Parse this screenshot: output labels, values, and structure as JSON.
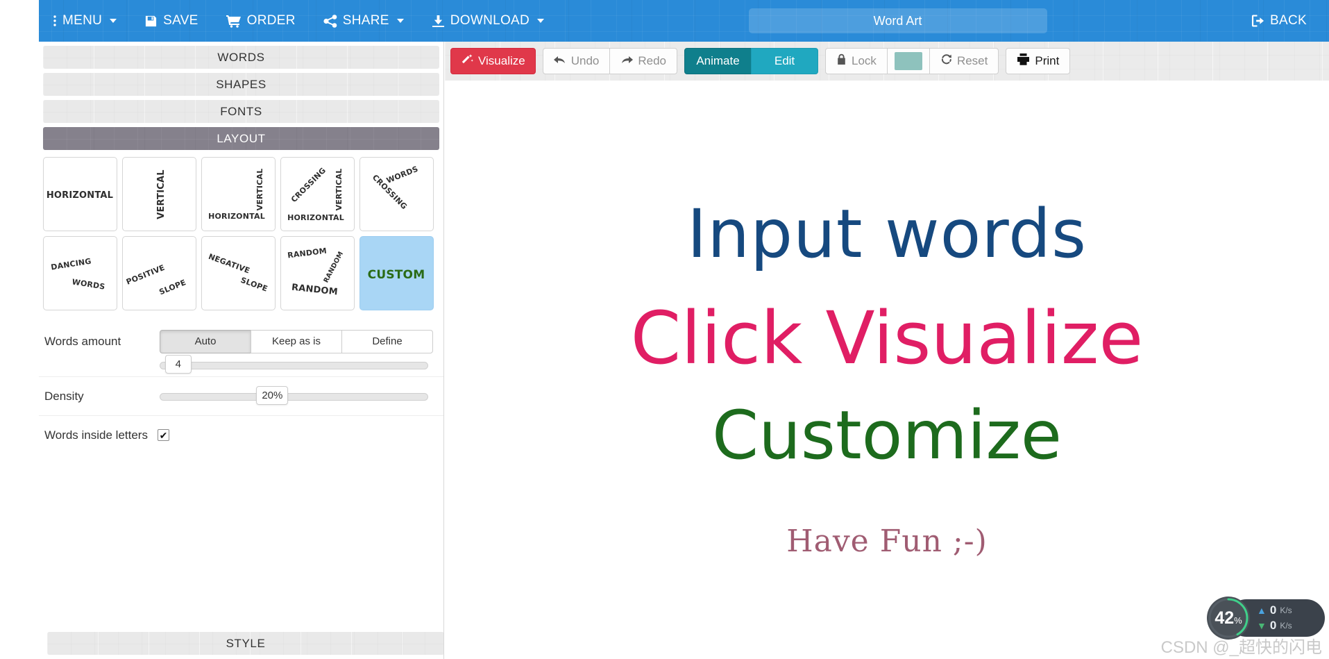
{
  "topbar": {
    "menu_label": "MENU",
    "save_label": "SAVE",
    "order_label": "ORDER",
    "share_label": "SHARE",
    "download_label": "DOWNLOAD",
    "title_value": "Word Art",
    "title_placeholder": "Word Art",
    "back_label": "BACK",
    "background_color": "#2a8bd8"
  },
  "toolbar": {
    "visualize_label": "Visualize",
    "undo_label": "Undo",
    "redo_label": "Redo",
    "animate_label": "Animate",
    "edit_label": "Edit",
    "lock_label": "Lock",
    "reset_label": "Reset",
    "print_label": "Print",
    "swatch_color": "#8ec2bd",
    "visualize_color": "#e0384a",
    "animate_color": "#0f7f8c",
    "edit_color": "#20a8c0"
  },
  "sidebar": {
    "sections": [
      {
        "label": "WORDS",
        "active": false
      },
      {
        "label": "SHAPES",
        "active": false
      },
      {
        "label": "FONTS",
        "active": false
      },
      {
        "label": "LAYOUT",
        "active": true
      }
    ],
    "bottom_section": {
      "label": "STYLE",
      "active": false
    }
  },
  "layout_options": [
    {
      "id": "horizontal",
      "name": "Horizontal",
      "lines": [
        "Horizontal"
      ],
      "selected": false
    },
    {
      "id": "vertical",
      "name": "Vertical",
      "lines": [
        "Vertical"
      ],
      "selected": false
    },
    {
      "id": "crossing",
      "name": "Crossing",
      "lines": [
        "Vertical",
        "Horizontal"
      ],
      "selected": false
    },
    {
      "id": "crossing-vertical",
      "name": "Crossing Vertical",
      "lines": [
        "Crossing",
        "Vertical",
        "Horizontal"
      ],
      "selected": false
    },
    {
      "id": "crossing-words",
      "name": "Crossing Words",
      "lines": [
        "Crossing",
        "Words"
      ],
      "selected": false
    },
    {
      "id": "dancing-words",
      "name": "Dancing Words",
      "lines": [
        "Dancing",
        "Words"
      ],
      "selected": false
    },
    {
      "id": "positive-slope",
      "name": "Positive Slope",
      "lines": [
        "Positive",
        "Slope"
      ],
      "selected": false
    },
    {
      "id": "negative-slope",
      "name": "Negative Slope",
      "lines": [
        "Negative",
        "Slope"
      ],
      "selected": false
    },
    {
      "id": "random",
      "name": "Random",
      "lines": [
        "Random",
        "Random",
        "Random"
      ],
      "selected": false
    },
    {
      "id": "custom",
      "name": "Custom",
      "lines": [
        "Custom"
      ],
      "selected": true
    }
  ],
  "controls": {
    "words_amount": {
      "label": "Words amount",
      "options": [
        "Auto",
        "Keep as is",
        "Define"
      ],
      "selected": "Auto",
      "slider_value": "4",
      "slider_percent": 6
    },
    "density": {
      "label": "Density",
      "value": "20%",
      "slider_percent": 38
    },
    "words_inside_letters": {
      "label": "Words inside letters",
      "checked": true,
      "check_glyph": "✔"
    }
  },
  "canvas": {
    "lines": [
      {
        "text": "Input words",
        "color": "#16497f"
      },
      {
        "text": "Click Visualize",
        "color": "#e01e64"
      },
      {
        "text": "Customize",
        "color": "#1d6b1d"
      },
      {
        "text": "Have Fun ;-)",
        "color": "#a05c72"
      }
    ]
  },
  "net_widget": {
    "percent": "42",
    "percent_sign": "%",
    "upload_value": "0",
    "upload_unit": "K/s",
    "download_value": "0",
    "download_unit": "K/s"
  },
  "watermark": {
    "text": "CSDN @_超快的闪电"
  }
}
